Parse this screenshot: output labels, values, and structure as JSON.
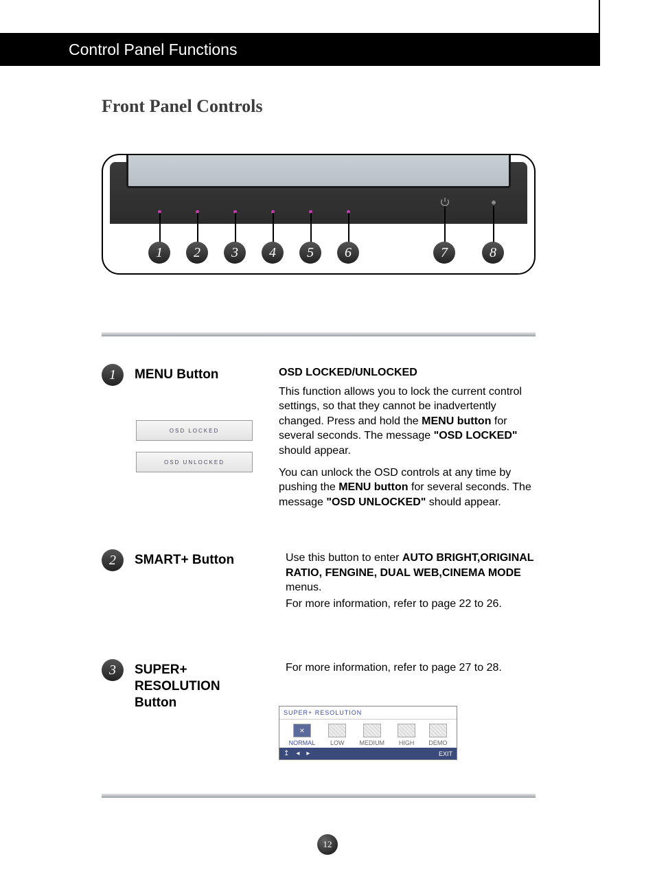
{
  "header": {
    "title": "Control Panel Functions"
  },
  "subtitle": "Front Panel Controls",
  "diagram": {
    "buttons": [
      "1",
      "2",
      "3",
      "4",
      "5",
      "6",
      "7",
      "8"
    ]
  },
  "items": [
    {
      "num": "1",
      "label": "MENU Button",
      "osd_locked": "OSD LOCKED",
      "osd_unlocked": "OSD UNLOCKED",
      "heading": "OSD LOCKED/UNLOCKED",
      "p1a": "This function allows you to lock the current control settings, so that they cannot be inadvertently changed. Press and hold the ",
      "p1b": "MENU button",
      "p1c": " for several seconds. The message ",
      "p1d": "\"OSD LOCKED\"",
      "p1e": " should appear.",
      "p2a": "You can unlock the OSD controls at any time by pushing the ",
      "p2b": "MENU button",
      "p2c": " for several seconds. The message ",
      "p2d": "\"OSD UNLOCKED\"",
      "p2e": " should appear."
    },
    {
      "num": "2",
      "label": "SMART+ Button",
      "p1a": "Use this button to enter ",
      "p1b": "AUTO BRIGHT,ORIGINAL RATIO, FENGINE, DUAL WEB,CINEMA MODE",
      "p1c": " menus.",
      "p2": "For more information, refer to page 22 to 26."
    },
    {
      "num": "3",
      "label": "SUPER+ RESOLUTION Button",
      "p1": "For more information, refer to page 27 to 28."
    }
  ],
  "sr_widget": {
    "title": "SUPER+  RESOLUTION",
    "options": [
      "NORMAL",
      "LOW",
      "MEDIUM",
      "HIGH",
      "DEMO"
    ],
    "selected": "NORMAL",
    "exit": "EXIT"
  },
  "page_number": "12"
}
